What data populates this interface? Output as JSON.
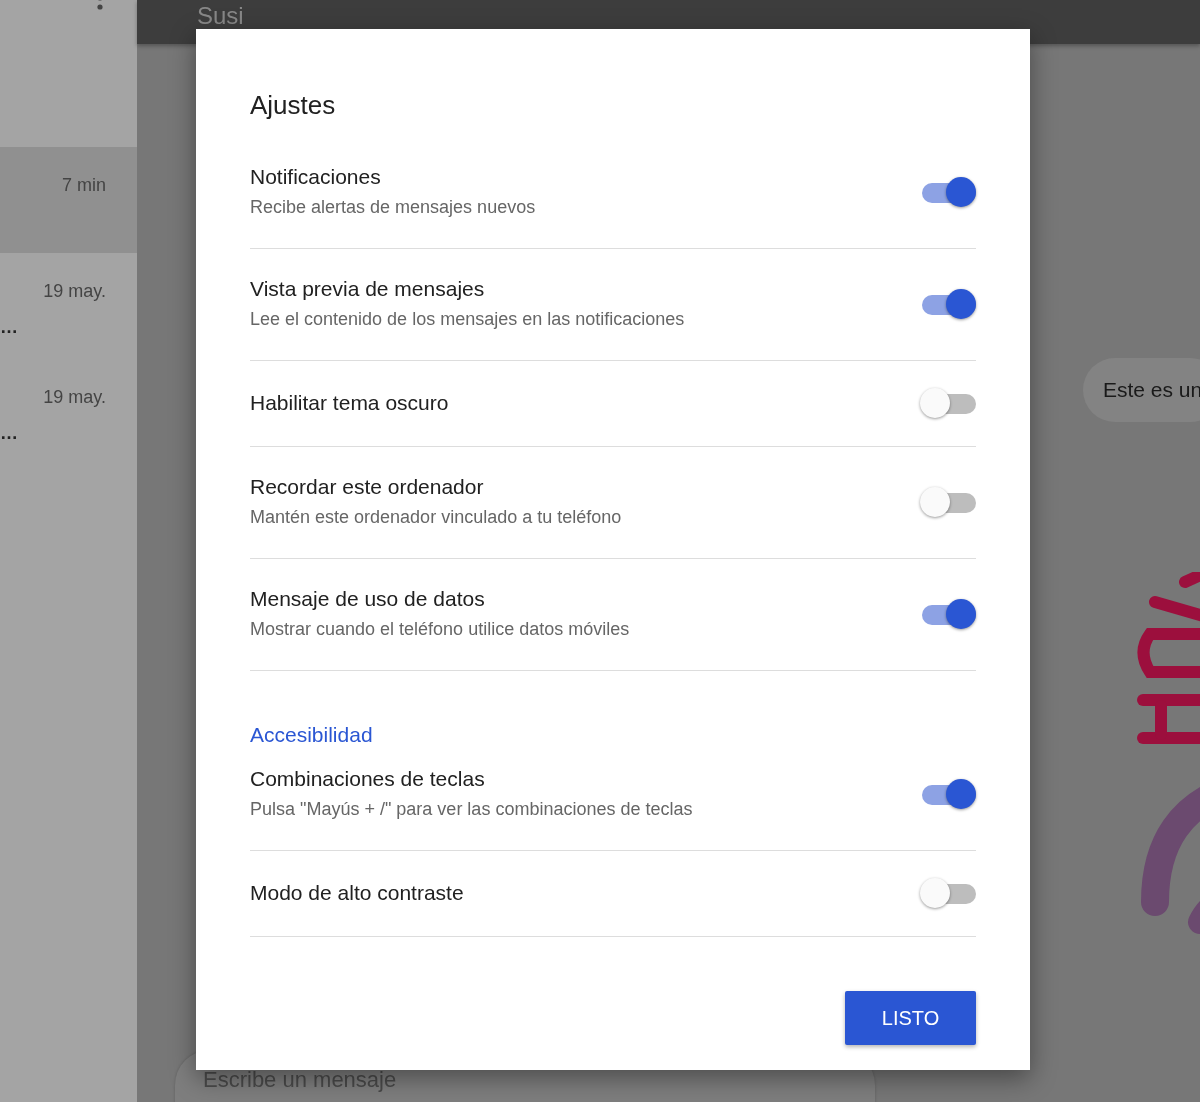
{
  "sidebar": {
    "conversations": [
      {
        "time": "7 min",
        "selected": true
      },
      {
        "time": "19 may.",
        "preview": "…",
        "selected": false
      },
      {
        "time": "19 may.",
        "preview": "…",
        "selected": false
      }
    ]
  },
  "header": {
    "title": "Susi"
  },
  "chat": {
    "messages": [
      {
        "text": "Este es un"
      }
    ]
  },
  "composer": {
    "placeholder": "Escribe un mensaje"
  },
  "dialog": {
    "title": "Ajustes",
    "sections": [
      {
        "items": [
          {
            "label": "Notificaciones",
            "description": "Recibe alertas de mensajes nuevos",
            "on": true
          },
          {
            "label": "Vista previa de mensajes",
            "description": "Lee el contenido de los mensajes en las notificaciones",
            "on": true
          },
          {
            "label": "Habilitar tema oscuro",
            "on": false
          },
          {
            "label": "Recordar este ordenador",
            "description": "Mantén este ordenador vinculado a tu teléfono",
            "on": false
          },
          {
            "label": "Mensaje de uso de datos",
            "description": "Mostrar cuando el teléfono utilice datos móviles",
            "on": true
          }
        ]
      },
      {
        "heading": "Accesibilidad",
        "items": [
          {
            "label": "Combinaciones de teclas",
            "description": "Pulsa \"Mayús + /\" para ver las combinaciones de teclas",
            "on": true
          },
          {
            "label": "Modo de alto contraste",
            "on": false
          }
        ]
      }
    ],
    "button": "LISTO"
  }
}
